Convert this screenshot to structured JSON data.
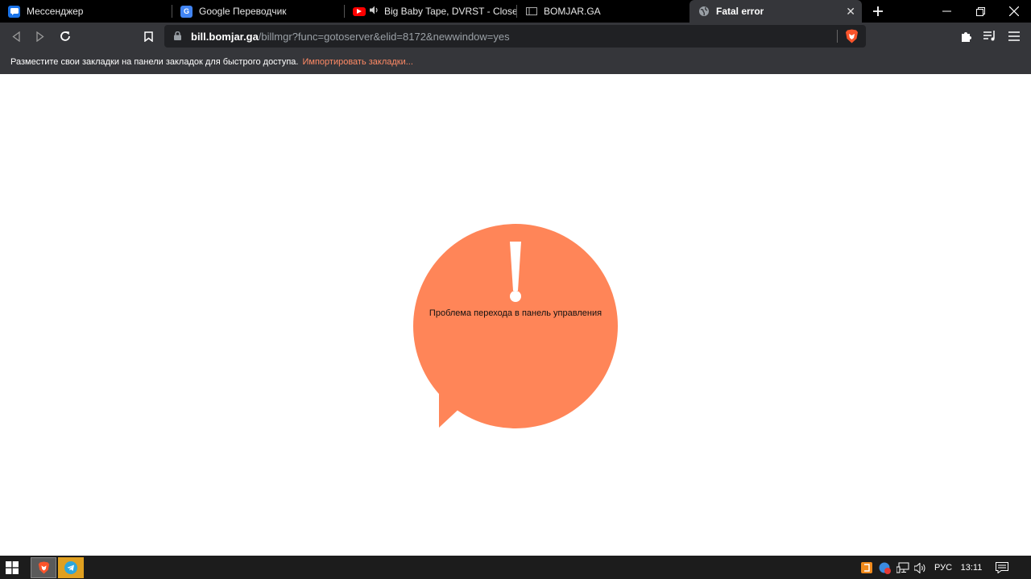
{
  "tabs": [
    {
      "label": "Мессенджер",
      "icon": "messenger-icon",
      "color": "#1a73e8"
    },
    {
      "label": "Google Переводчик",
      "icon": "google-translate-icon",
      "color": "#4285f4"
    },
    {
      "label": "Big Baby Tape, DVRST - Close Gu",
      "icon": "youtube-icon",
      "color": "#ff0000",
      "audio": true
    },
    {
      "label": "BOMJAR.GA",
      "icon": "page-icon"
    },
    {
      "label": "Fatal error",
      "icon": "globe-icon",
      "active": true
    }
  ],
  "toolbar": {
    "url_host": "bill.bomjar.ga",
    "url_path": "/billmgr?func=gotoserver&elid=8172&newwindow=yes"
  },
  "bookmarks_bar": {
    "hint": "Разместите свои закладки на панели закладок для быстрого доступа.",
    "import_link": "Импортировать закладки..."
  },
  "error": {
    "message": "Проблема перехода в панель управления",
    "bubble_color": "#ff8558"
  },
  "taskbar": {
    "language": "РУС",
    "time": "13:11"
  }
}
